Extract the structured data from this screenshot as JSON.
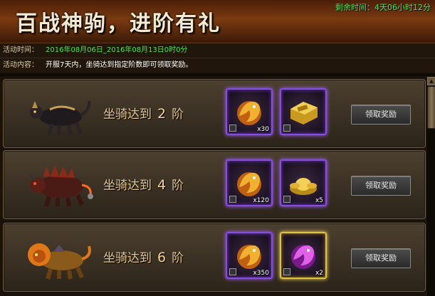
{
  "header": {
    "title": "百战神驹，进阶有礼",
    "countdown": "剩余时间：4天06小时12分"
  },
  "info": {
    "time_label": "活动时间：",
    "time_value": "2016年08月06日_2016年08月13日0时0分",
    "content_label": "活动内容：",
    "content_value": "开服7天内，坐骑达到指定阶数即可领取奖励。"
  },
  "tiers": [
    {
      "prefix": "坐骑达到",
      "level": "2",
      "suffix": "阶",
      "rewards": [
        {
          "icon": "golden-dragon-icon",
          "qty": "x30"
        },
        {
          "icon": "gold-ingot-bar-icon",
          "qty": ""
        }
      ],
      "button": "领取奖励"
    },
    {
      "prefix": "坐骑达到",
      "level": "4",
      "suffix": "阶",
      "rewards": [
        {
          "icon": "golden-dragon-icon",
          "qty": "x120"
        },
        {
          "icon": "gold-yuanbao-icon",
          "qty": "x5"
        }
      ],
      "button": "领取奖励"
    },
    {
      "prefix": "坐骑达到",
      "level": "6",
      "suffix": "阶",
      "rewards": [
        {
          "icon": "golden-dragon-icon",
          "qty": "x350"
        },
        {
          "icon": "purple-dragon-icon",
          "qty": "x2"
        }
      ],
      "button": "领取奖励"
    }
  ],
  "colors": {
    "accent_green": "#4fe04f",
    "tier_text": "#e3c48c",
    "slot_purple": "#8a4ce0",
    "slot_gold": "#e0c040"
  }
}
